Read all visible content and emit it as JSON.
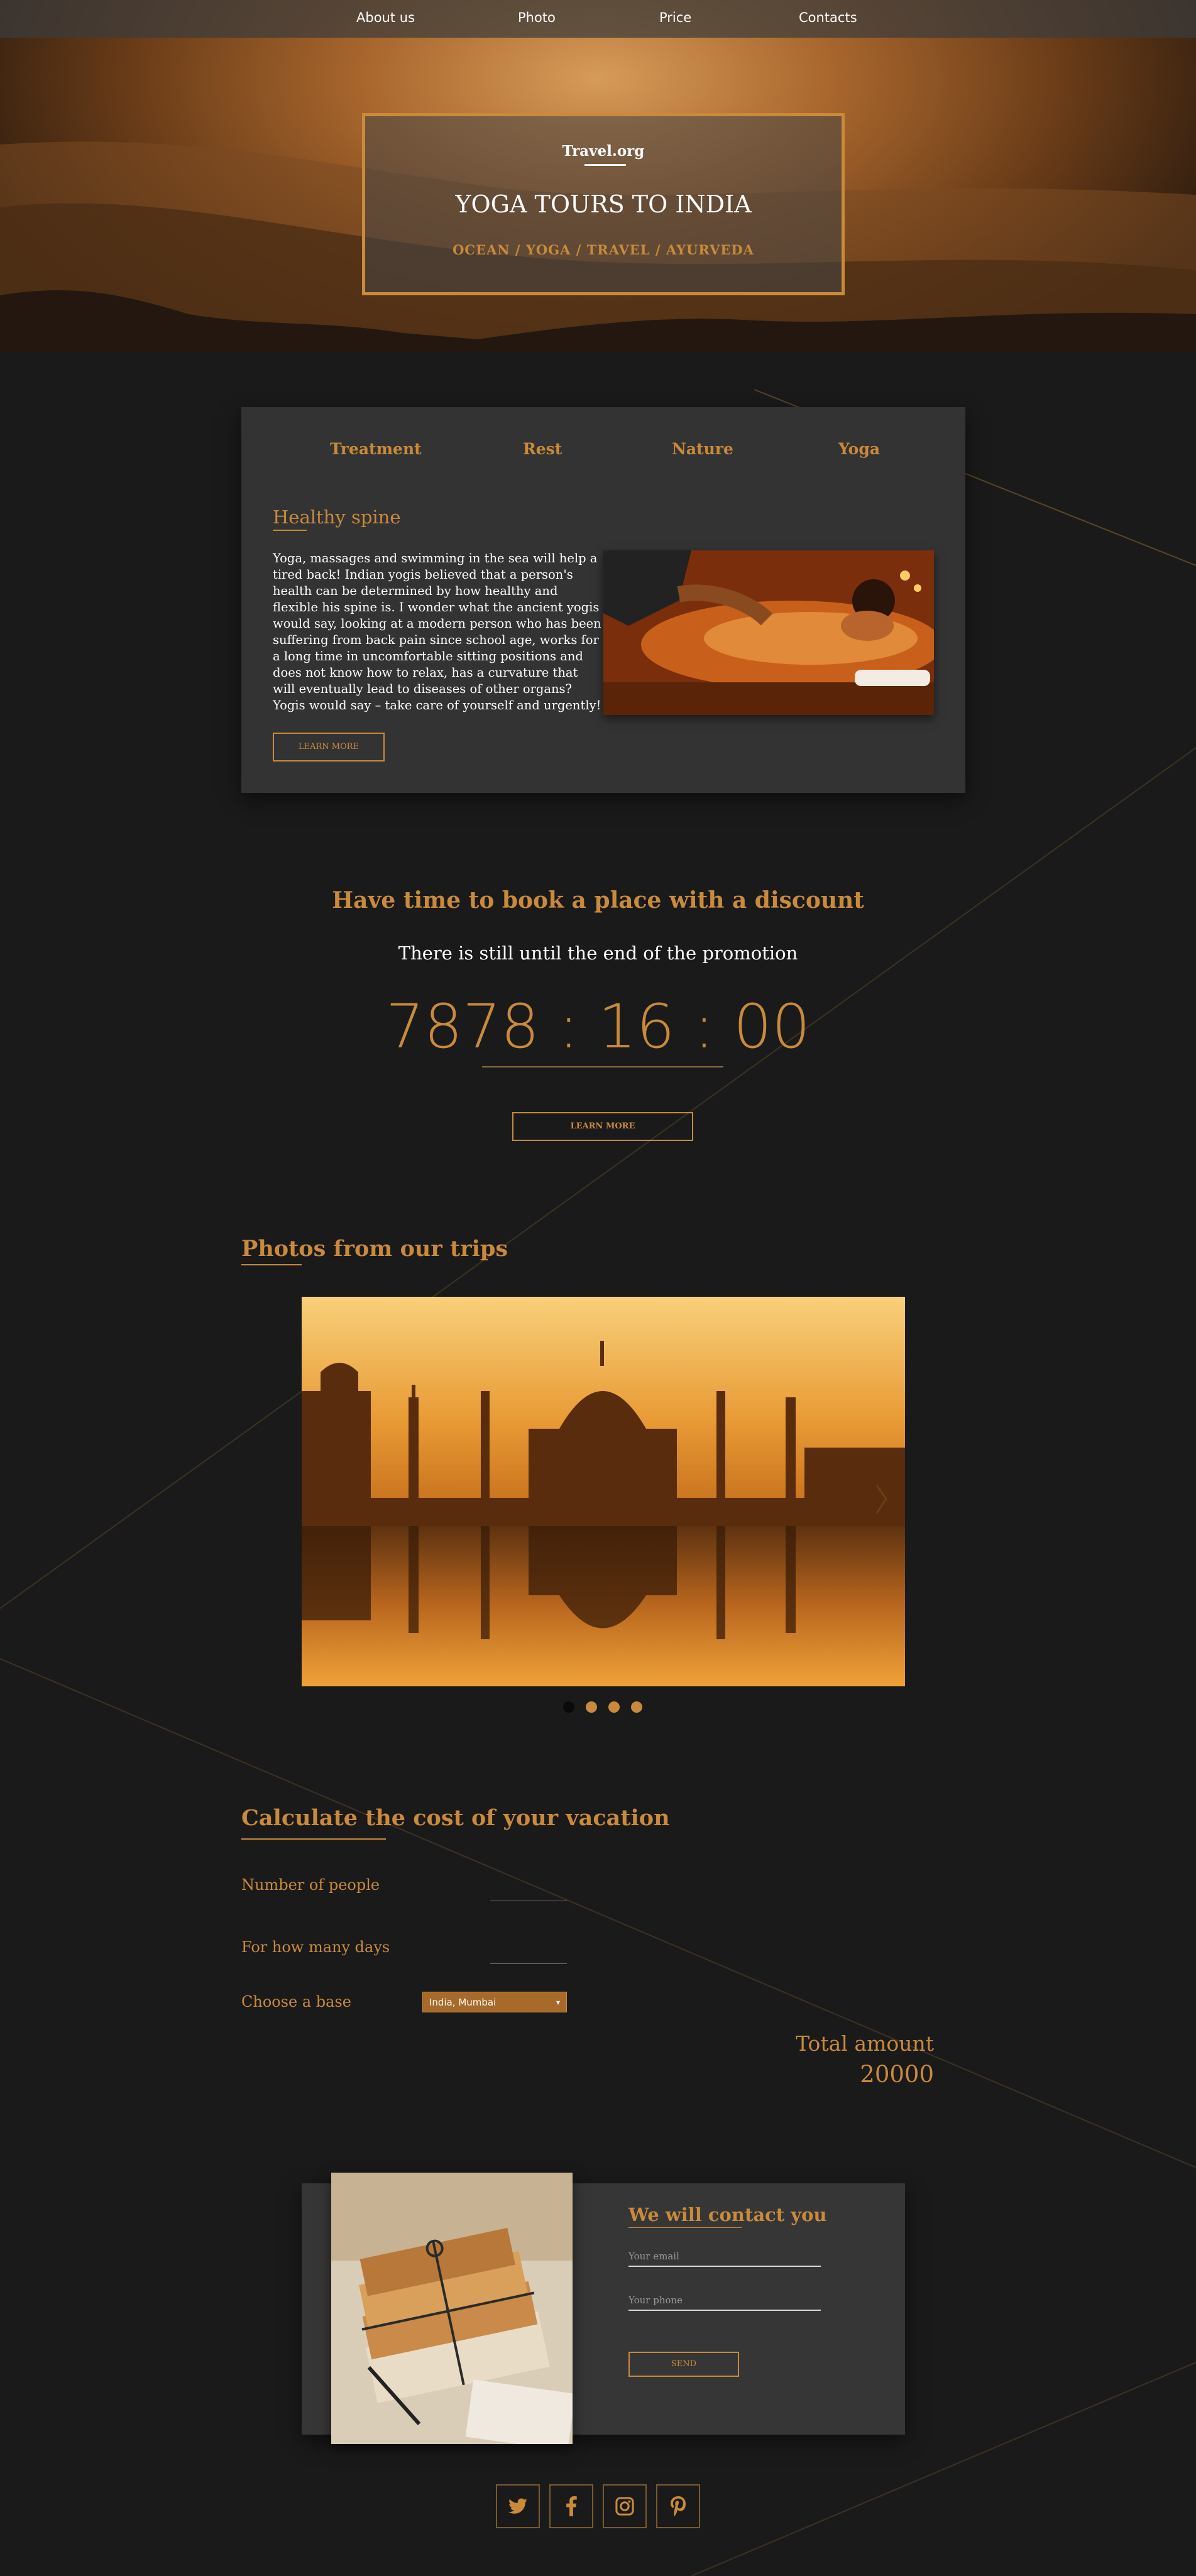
{
  "nav": {
    "items": [
      {
        "label": "About us"
      },
      {
        "label": "Photo"
      },
      {
        "label": "Price"
      },
      {
        "label": "Contacts"
      }
    ]
  },
  "hero": {
    "logo": "Travel.org",
    "title": "YOGA TOURS TO INDIA",
    "subtitle": "OCEAN / YOGA / TRAVEL / AYURVEDA"
  },
  "tabs": {
    "items": [
      {
        "label": "Treatment"
      },
      {
        "label": "Rest"
      },
      {
        "label": "Nature"
      },
      {
        "label": "Yoga"
      }
    ],
    "active_content": {
      "heading": "Healthy spine",
      "text": "Yoga, massages and swimming in the sea will help a tired back! Indian yogis believed that a person's health can be determined by how healthy and flexible his spine is. I wonder what the ancient yogis would say, looking at a modern person who has been suffering from back pain since school age, works for a long time in uncomfortable sitting positions and does not know how to relax, has a curvature that will eventually lead to diseases of other organs? Yogis would say – take care of yourself and urgently!",
      "button": "LEARN MORE"
    }
  },
  "promo": {
    "title": "Have time to book a place with a discount",
    "subtitle": "There is still until the end of the promotion",
    "timer": "7878 : 16 : 00",
    "button": "LEARN MORE"
  },
  "photos": {
    "title": "Photos from our trips",
    "active_slide": 1,
    "slide_count": 4
  },
  "calculator": {
    "title": "Calculate the cost of your vacation",
    "people_label": "Number of people",
    "people_value": "",
    "days_label": "For how many days",
    "days_value": "",
    "base_label": "Choose a base",
    "base_value": "India, Mumbai",
    "total_label": "Total amount",
    "total_value": "20000"
  },
  "contact": {
    "title": "We will contact you",
    "email_placeholder": "Your email",
    "phone_placeholder": "Your phone",
    "button": "SEND"
  },
  "social": {
    "icons": [
      "twitter-icon",
      "facebook-icon",
      "instagram-icon",
      "pinterest-icon"
    ]
  },
  "colors": {
    "accent": "#c98a3c",
    "background": "#1a1a1a",
    "panel": "#333333"
  }
}
